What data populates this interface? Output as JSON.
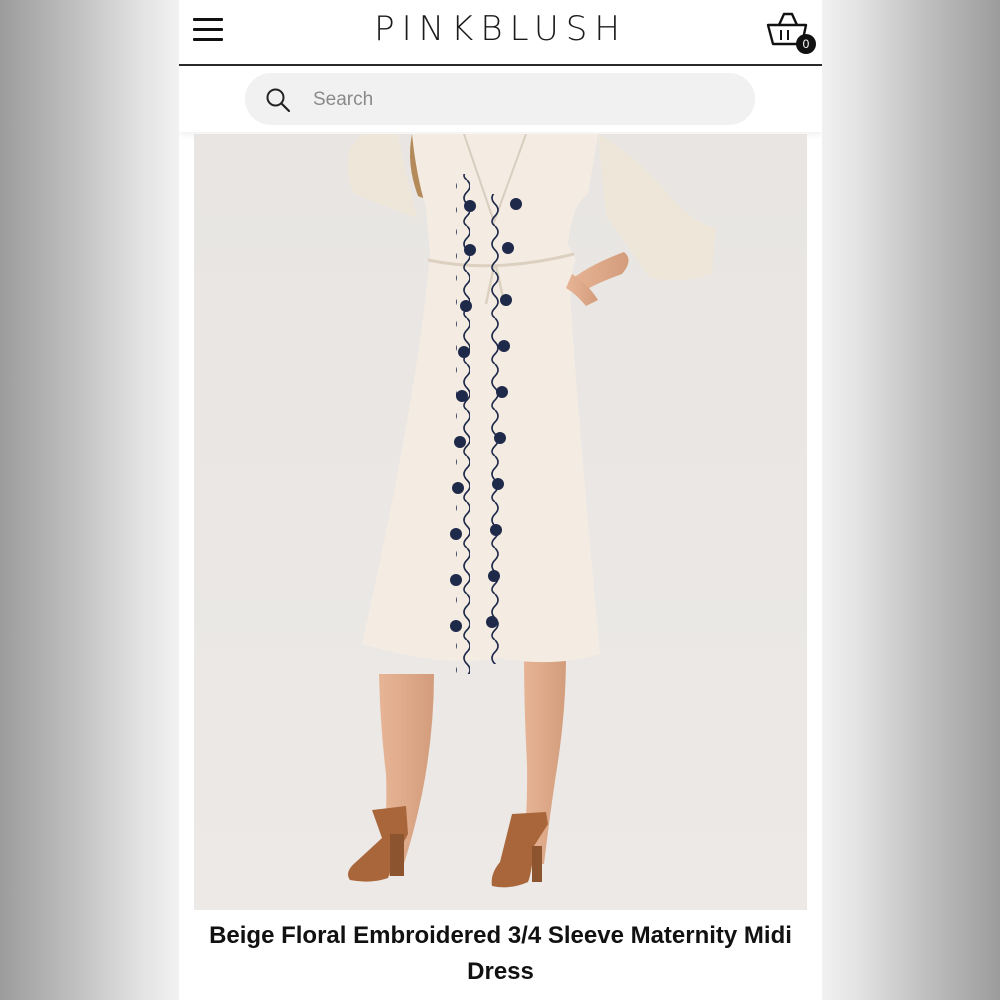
{
  "header": {
    "brand": "PINKBLUSH",
    "menu_icon": "hamburger-menu-icon",
    "cart_icon": "shopping-basket-icon",
    "cart_count": "0"
  },
  "search": {
    "placeholder": "Search",
    "icon": "search-icon"
  },
  "product": {
    "image_alt": "model wearing beige floral embroidered midi dress",
    "title": "Beige Floral Embroidered 3/4 Sleeve Maternity Midi Dress"
  },
  "colors": {
    "brand_text": "#1b1b1b",
    "dress": "#f4ece2",
    "embroidery": "#1f2a4a",
    "background_photo": "#e9e6e3"
  }
}
